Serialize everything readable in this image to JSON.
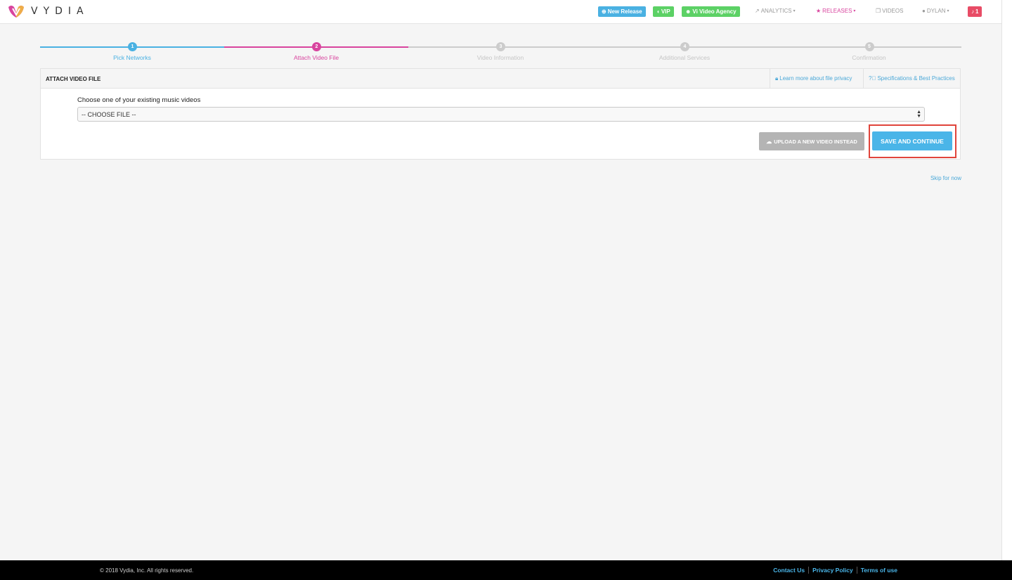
{
  "brand": {
    "name": "VYDIA"
  },
  "nav": {
    "new_release": "New Release",
    "vip": "VIP",
    "agency": "Vi Video Agency",
    "analytics": "ANALYTICS",
    "releases": "RELEASES",
    "videos": "VIDEOS",
    "user": "DYLAN",
    "notifications": "1"
  },
  "stepper": {
    "steps": [
      {
        "number": "1",
        "label": "Pick Networks",
        "state": "done"
      },
      {
        "number": "2",
        "label": "Attach Video File",
        "state": "active"
      },
      {
        "number": "3",
        "label": "Video Information",
        "state": "pending"
      },
      {
        "number": "4",
        "label": "Additional Services",
        "state": "pending"
      },
      {
        "number": "5",
        "label": "Confirmation",
        "state": "pending"
      }
    ]
  },
  "panel": {
    "title": "ATTACH VIDEO FILE",
    "privacy_link": "Learn more about file privacy",
    "specs_link": "Specifications & Best Practices",
    "field_label": "Choose one of your existing music videos",
    "select_value": "-- CHOOSE FILE --",
    "upload_button": "UPLOAD A NEW VIDEO INSTEAD",
    "save_button": "SAVE AND CONTINUE"
  },
  "skip_link": "Skip for now",
  "footer": {
    "copyright": "© 2018 Vydia, Inc. All rights reserved.",
    "contact": "Contact Us",
    "privacy": "Privacy Policy",
    "terms": "Terms of use"
  },
  "colors": {
    "blue": "#4ab1e2",
    "magenta": "#d8449e",
    "green": "#5cd165",
    "red": "#e84c66",
    "highlight": "#e0443b"
  }
}
